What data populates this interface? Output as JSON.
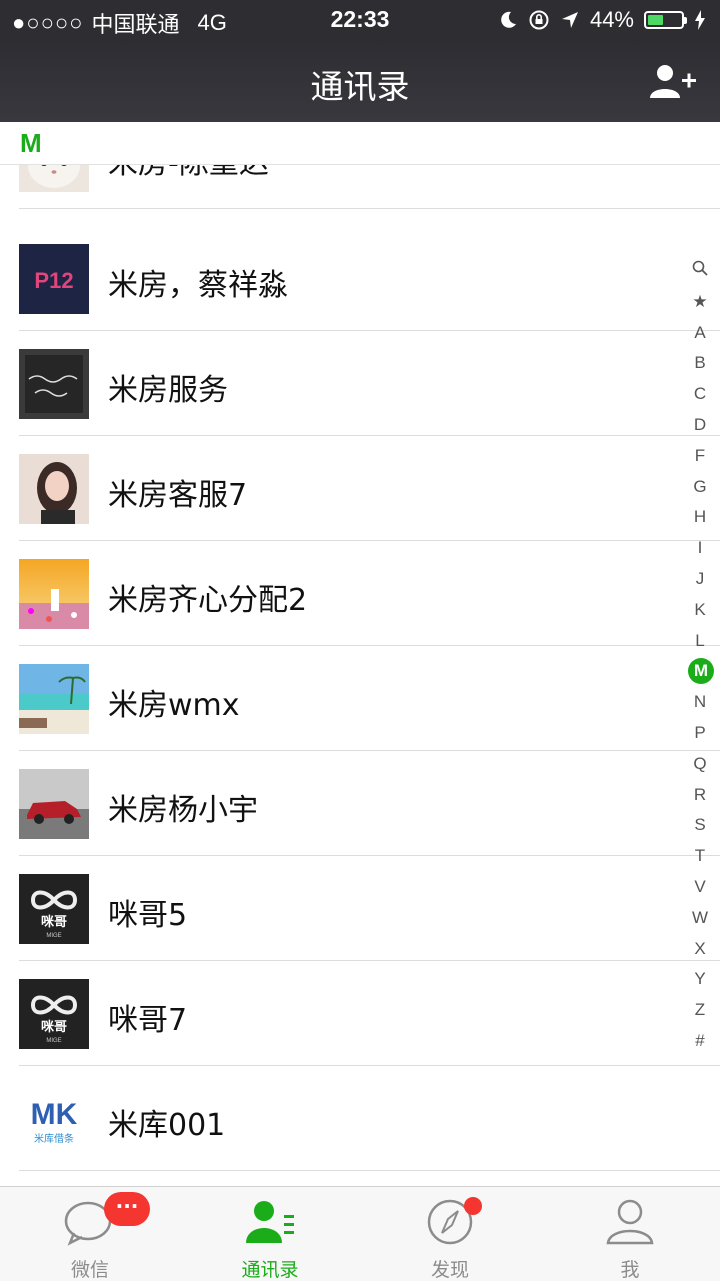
{
  "status": {
    "signal_dots": "●○○○○",
    "carrier": "中国联通",
    "network": "4G",
    "time": "22:33",
    "battery": "44%",
    "battery_level": 0.44
  },
  "nav": {
    "title": "通讯录"
  },
  "section_letter": "M",
  "contacts": [
    {
      "name": "米房-陈重达",
      "avatar": "cat-avatar"
    },
    {
      "name": "米房，蔡祥淼",
      "avatar": "p12-avatar"
    },
    {
      "name": "米房服务",
      "avatar": "calligraphy-avatar"
    },
    {
      "name": "米房客服7",
      "avatar": "girl-avatar"
    },
    {
      "name": "米房齐心分配2",
      "avatar": "flowers-avatar"
    },
    {
      "name": "米房wmx",
      "avatar": "beach-avatar"
    },
    {
      "name": "米房杨小宇",
      "avatar": "car-avatar"
    },
    {
      "name": "咪哥5",
      "avatar": "mige-logo-avatar"
    },
    {
      "name": "咪哥7",
      "avatar": "mige-logo-avatar"
    },
    {
      "name": "米库001",
      "avatar": "mk-logo-avatar"
    }
  ],
  "avatar_text": {
    "p12": "P12",
    "mige_cn": "咪哥",
    "mige_en": "MIGE",
    "mk": "MK",
    "mk_caption": "米库借条"
  },
  "index_letters": [
    "Q",
    "★",
    "A",
    "B",
    "C",
    "D",
    "F",
    "G",
    "H",
    "I",
    "J",
    "K",
    "L",
    "M",
    "N",
    "P",
    "Q",
    "R",
    "S",
    "T",
    "V",
    "W",
    "X",
    "Y",
    "Z",
    "#"
  ],
  "index_active": "M",
  "tabs": [
    {
      "label": "微信",
      "icon": "chat-bubble-icon",
      "badge": "···"
    },
    {
      "label": "通讯录",
      "icon": "contacts-icon",
      "active": true
    },
    {
      "label": "发现",
      "icon": "compass-icon",
      "dot": true
    },
    {
      "label": "我",
      "icon": "person-icon"
    }
  ],
  "colors": {
    "accent": "#1aad19",
    "badge": "#f43530",
    "navbar": "#2e2d32"
  }
}
